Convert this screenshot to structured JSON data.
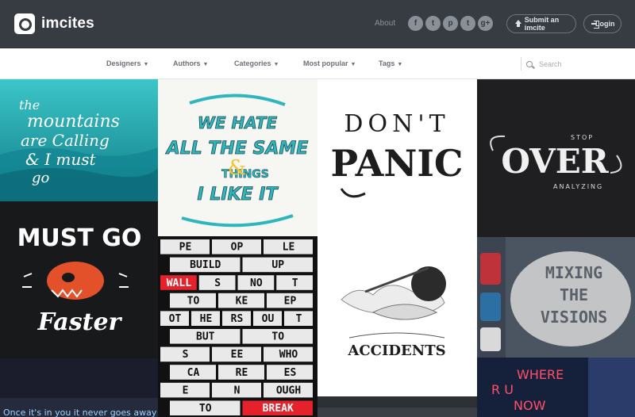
{
  "header": {
    "brand": "imcites",
    "about_label": "About",
    "social": [
      {
        "name": "facebook-icon",
        "glyph": "f"
      },
      {
        "name": "twitter-icon",
        "glyph": "t"
      },
      {
        "name": "pinterest-icon",
        "glyph": "p"
      },
      {
        "name": "tumblr-icon",
        "glyph": "t"
      },
      {
        "name": "googleplus-icon",
        "glyph": "g+"
      }
    ],
    "submit_label": "Submit an imcite",
    "login_label": "Login"
  },
  "nav": {
    "items": [
      "Designers",
      "Authors",
      "Categories",
      "Most popular",
      "Tags"
    ],
    "search_placeholder": "Search"
  },
  "tiles": {
    "mountains": [
      "the",
      "mountains",
      "are Calling",
      "& I must",
      "go"
    ],
    "hate": [
      "WE HATE",
      "ALL THE SAME",
      "THINGS",
      "I LIKE IT"
    ],
    "panic": [
      "DON'T",
      "PANIC"
    ],
    "over": [
      "STOP",
      "OVER",
      "ANALYZING"
    ],
    "mustgo": [
      "MUST GO",
      "Faster"
    ],
    "bricks": [
      [
        "PE",
        "OP",
        "LE"
      ],
      [
        "BUILD",
        "UP"
      ],
      [
        "WALL",
        "S",
        "NO",
        "T"
      ],
      [
        "TO",
        "KE",
        "EP"
      ],
      [
        "OT",
        "HE",
        "RS",
        "OU",
        "T"
      ],
      [
        "BUT",
        "TO"
      ],
      [
        "S",
        "EE",
        "WHO"
      ],
      [
        "CA",
        "RE",
        "ES"
      ],
      [
        "E",
        "N",
        "OUGH"
      ],
      [
        "TO",
        "BREAK"
      ]
    ],
    "accidents": [
      "ACCIDENTS"
    ],
    "mixing": [
      "MIXING",
      "THE",
      "VISIONS"
    ],
    "neon_left": [
      "Once it's in you it never goes away"
    ],
    "neon_right": [
      "WHERE",
      "R U",
      "NOW"
    ]
  },
  "colors": {
    "header_bg": "#373c42",
    "nav_bg": "#ffffff",
    "teal": "#2fb6bd",
    "brick_red": "#e5222b"
  }
}
